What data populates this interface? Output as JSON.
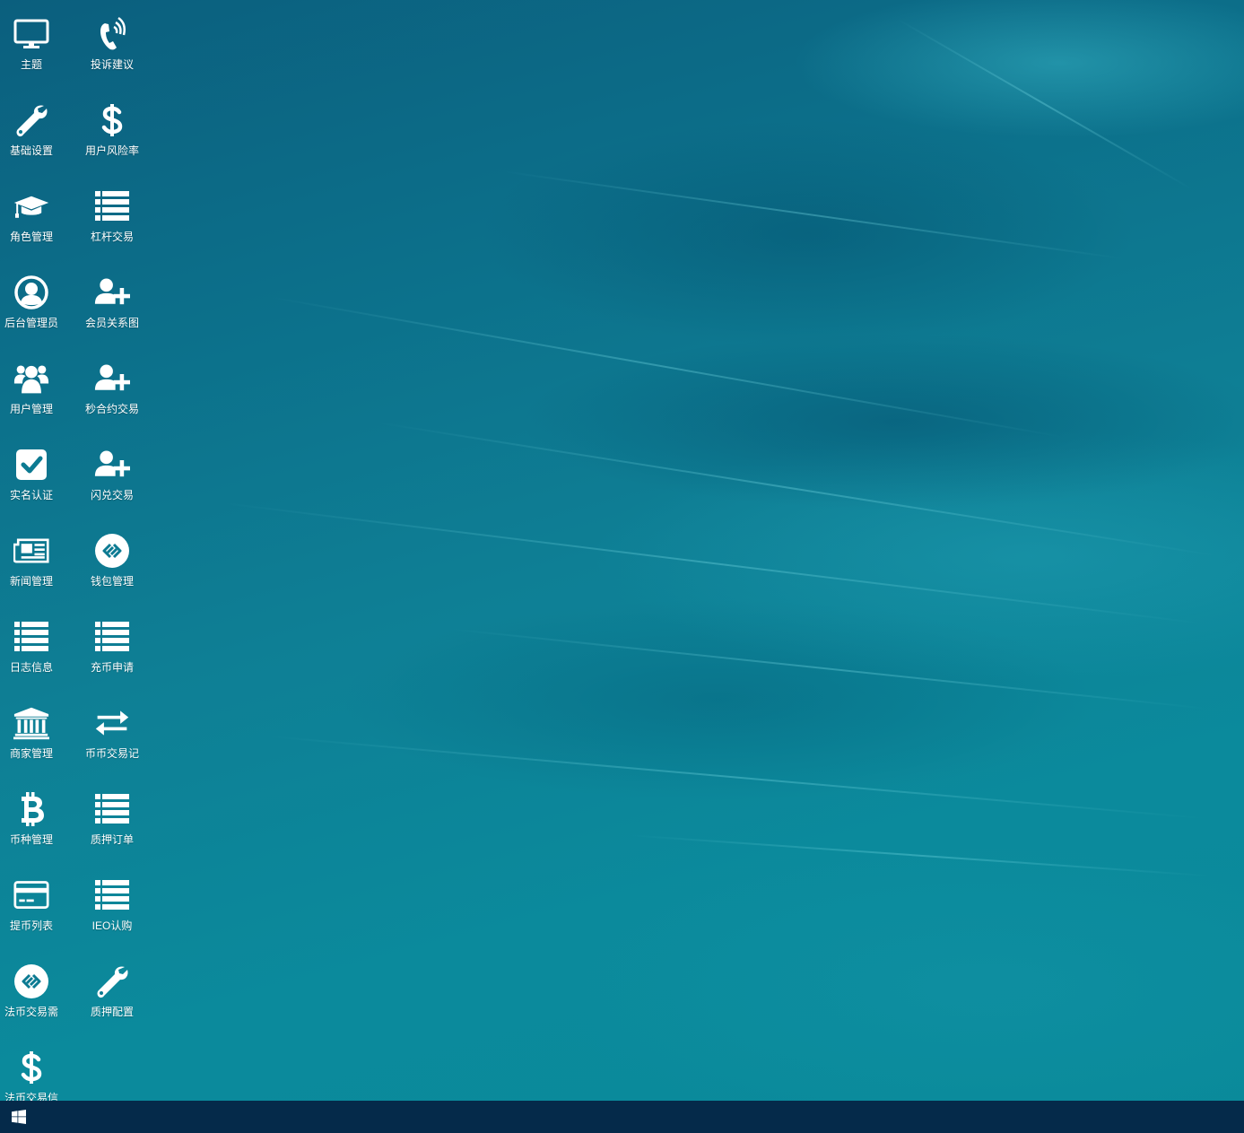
{
  "desktop": {
    "icons": [
      {
        "label": "主题",
        "icon": "monitor-icon"
      },
      {
        "label": "投诉建议",
        "icon": "phone-volume-icon"
      },
      {
        "label": "基础设置",
        "icon": "wrench-icon"
      },
      {
        "label": "用户风险率",
        "icon": "dollar-icon"
      },
      {
        "label": "角色管理",
        "icon": "graduation-cap-icon"
      },
      {
        "label": "杠杆交易",
        "icon": "list-icon"
      },
      {
        "label": "后台管理员",
        "icon": "user-circle-icon"
      },
      {
        "label": "会员关系图",
        "icon": "user-plus-icon"
      },
      {
        "label": "用户管理",
        "icon": "users-icon"
      },
      {
        "label": "秒合约交易",
        "icon": "user-plus-icon"
      },
      {
        "label": "实名认证",
        "icon": "check-square-icon"
      },
      {
        "label": "闪兑交易",
        "icon": "user-plus-icon"
      },
      {
        "label": "新闻管理",
        "icon": "newspaper-icon"
      },
      {
        "label": "钱包管理",
        "icon": "link-circle-icon"
      },
      {
        "label": "日志信息",
        "icon": "list-icon"
      },
      {
        "label": "充币申请",
        "icon": "list-icon"
      },
      {
        "label": "商家管理",
        "icon": "bank-icon"
      },
      {
        "label": "币币交易记",
        "icon": "exchange-icon"
      },
      {
        "label": "币种管理",
        "icon": "bitcoin-icon"
      },
      {
        "label": "质押订单",
        "icon": "list-icon"
      },
      {
        "label": "提币列表",
        "icon": "credit-card-icon"
      },
      {
        "label": "IEO认购",
        "icon": "list-icon"
      },
      {
        "label": "法币交易需",
        "icon": "link-circle-icon"
      },
      {
        "label": "质押配置",
        "icon": "wrench-icon"
      },
      {
        "label": "法币交易信",
        "icon": "dollar-icon"
      }
    ]
  },
  "taskbar": {
    "start_icon": "windows-start-icon",
    "background": "#052a4a"
  },
  "colors": {
    "desktop_base": "#0c7a92",
    "icon_color": "#ffffff"
  }
}
